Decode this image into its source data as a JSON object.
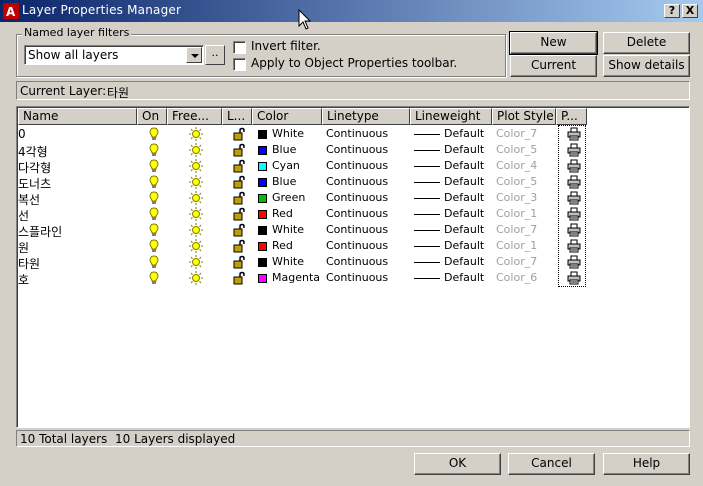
{
  "window": {
    "title": "Layer Properties Manager",
    "help_glyph": "?",
    "close_glyph": "X"
  },
  "filters": {
    "group_label": "Named layer filters",
    "selected": "Show all layers",
    "browse_label": "..",
    "invert_label": "Invert filter.",
    "invert_checked": false,
    "apply_label": "Apply to Object Properties toolbar.",
    "apply_checked": false
  },
  "buttons": {
    "new": "New",
    "delete": "Delete",
    "current": "Current",
    "show_details": "Show details",
    "ok": "OK",
    "cancel": "Cancel",
    "help": "Help"
  },
  "current_layer": {
    "label": "Current Layer:",
    "value": "타원"
  },
  "columns": [
    "Name",
    "On",
    "Free...",
    "L...",
    "Color",
    "Linetype",
    "Lineweight",
    "Plot Style",
    "P..."
  ],
  "layers": [
    {
      "name": "0",
      "color": "White",
      "color_hex": "#000000",
      "linetype": "Continuous",
      "lineweight": "Default",
      "plot_style": "Color_7"
    },
    {
      "name": "4각형",
      "color": "Blue",
      "color_hex": "#0000ff",
      "linetype": "Continuous",
      "lineweight": "Default",
      "plot_style": "Color_5"
    },
    {
      "name": "다각형",
      "color": "Cyan",
      "color_hex": "#00ffff",
      "linetype": "Continuous",
      "lineweight": "Default",
      "plot_style": "Color_4"
    },
    {
      "name": "도너츠",
      "color": "Blue",
      "color_hex": "#0000ff",
      "linetype": "Continuous",
      "lineweight": "Default",
      "plot_style": "Color_5"
    },
    {
      "name": "복선",
      "color": "Green",
      "color_hex": "#00c000",
      "linetype": "Continuous",
      "lineweight": "Default",
      "plot_style": "Color_3"
    },
    {
      "name": "선",
      "color": "Red",
      "color_hex": "#ff0000",
      "linetype": "Continuous",
      "lineweight": "Default",
      "plot_style": "Color_1"
    },
    {
      "name": "스플라인",
      "color": "White",
      "color_hex": "#000000",
      "linetype": "Continuous",
      "lineweight": "Default",
      "plot_style": "Color_7"
    },
    {
      "name": "원",
      "color": "Red",
      "color_hex": "#ff0000",
      "linetype": "Continuous",
      "lineweight": "Default",
      "plot_style": "Color_1"
    },
    {
      "name": "타원",
      "color": "White",
      "color_hex": "#000000",
      "linetype": "Continuous",
      "lineweight": "Default",
      "plot_style": "Color_7"
    },
    {
      "name": "호",
      "color": "Magenta",
      "color_hex": "#ff00ff",
      "linetype": "Continuous",
      "lineweight": "Default",
      "plot_style": "Color_6"
    }
  ],
  "status": {
    "total": "10 Total layers",
    "displayed": "10 Layers displayed"
  },
  "icons": {
    "on": "lightbulb-icon",
    "freeze": "sun-icon",
    "lock": "unlock-icon",
    "plot": "printer-icon"
  }
}
